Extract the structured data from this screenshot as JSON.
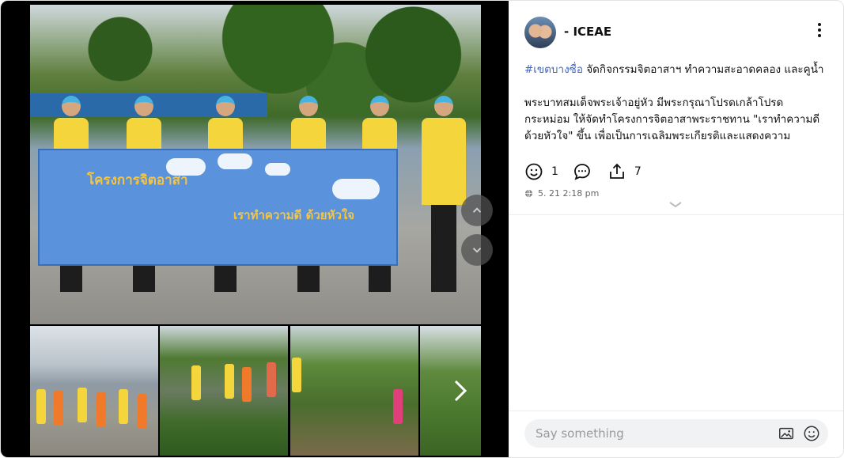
{
  "post": {
    "author": "- ICEAE",
    "hashtag": "#เขตบางซื่อ",
    "line1": " จัดกิจกรรมจิตอาสาฯ ทำความสะอาดคลอง และคูน้ำ",
    "body": "พระบาทสมเด็จพระเจ้าอยู่หัว มีพระกรุณาโปรดเกล้าโปรดกระหม่อม ให้จัดทำโครงการจิตอาสาพระราชทาน \"เราทำความดี ด้วยหัวใจ\" ขึ้น เพื่อเป็นการเฉลิมพระเกียรติและแสดงความ",
    "reactions": {
      "like_count": "1",
      "share_count": "7"
    },
    "timestamp": "5. 21 2:18 pm"
  },
  "banner": {
    "title": "โครงการจิตอาสา",
    "slogan": "เราทำความดี ด้วยหัวใจ"
  },
  "icons": {
    "more": "more-vert-icon",
    "like": "smile-icon",
    "comment": "comment-icon",
    "share": "share-icon",
    "globe": "globe-icon",
    "expand": "chevron-down-icon",
    "image": "image-icon",
    "emoji": "emoji-icon",
    "next": "chevron-right-icon"
  },
  "composer": {
    "placeholder": "Say something"
  },
  "colors": {
    "hashtag": "#3b64c9",
    "background": "#ffffff",
    "media_bg": "#000000"
  }
}
